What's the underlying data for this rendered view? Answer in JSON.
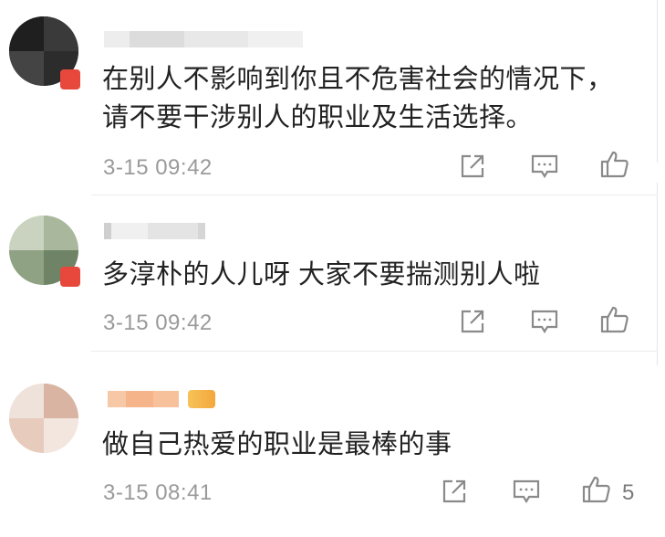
{
  "comments": [
    {
      "username": "",
      "text": "在别人不影响到你且不危害社会的情况下，\n请不要干涉别人的职业及生活选择。",
      "time": "3-15 09:42",
      "actions": {
        "share_icon": "share-icon",
        "reply_icon": "comment-icon",
        "like_icon": "thumbs-up-icon"
      },
      "likes": ""
    },
    {
      "username": "",
      "text": "多淳朴的人儿呀 大家不要揣测别人啦",
      "time": "3-15 09:42",
      "actions": {
        "share_icon": "share-icon",
        "reply_icon": "comment-icon",
        "like_icon": "thumbs-up-icon"
      },
      "likes": ""
    },
    {
      "username": "",
      "text": "做自己热爱的职业是最棒的事",
      "time": "3-15 08:41",
      "actions": {
        "share_icon": "share-icon",
        "reply_icon": "comment-icon",
        "like_icon": "thumbs-up-icon"
      },
      "likes": "5"
    }
  ],
  "colors": {
    "text": "#222222",
    "meta": "#9a9a9a",
    "icon": "#8a8a8a",
    "badge_red": "#e8483c",
    "vip_gold": "#f3a73b"
  }
}
